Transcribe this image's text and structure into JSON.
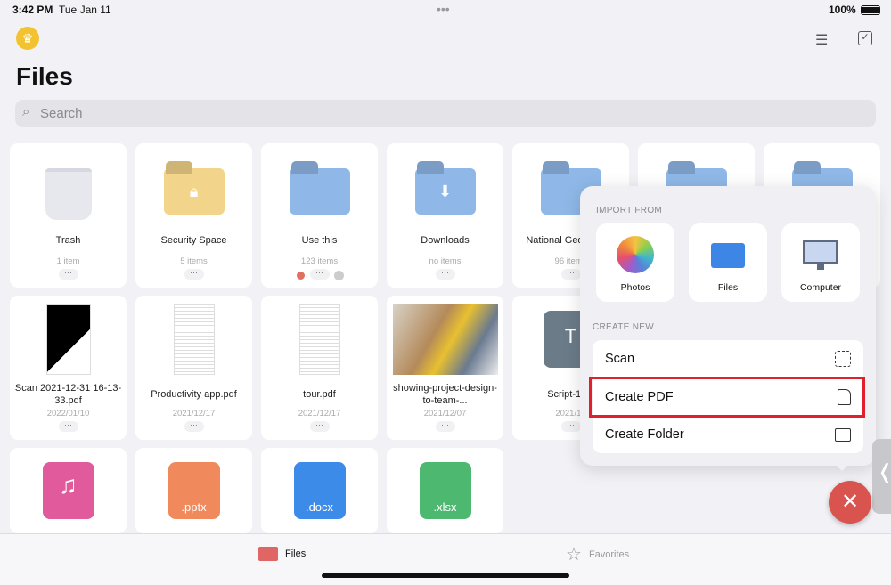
{
  "status": {
    "time": "3:42 PM",
    "date": "Tue Jan 11",
    "battery": "100%"
  },
  "header": {
    "title": "Files",
    "search_placeholder": "Search"
  },
  "row1": [
    {
      "name": "Trash",
      "sub": "1 item",
      "icon": "trash-icon"
    },
    {
      "name": "Security Space",
      "sub": "5 items",
      "icon": "lock-folder-icon"
    },
    {
      "name": "Use this",
      "sub": "123 items",
      "icon": "folder-icon"
    },
    {
      "name": "Downloads",
      "sub": "no items",
      "icon": "download-folder-icon"
    },
    {
      "name": "National Geographic",
      "sub": "96 items",
      "icon": "folder-icon"
    },
    {
      "name": "",
      "sub": "",
      "icon": "folder-icon"
    },
    {
      "name": "",
      "sub": "",
      "icon": "folder-icon"
    }
  ],
  "row2": [
    {
      "name": "Scan 2021-12-31 16-13-33.pdf",
      "sub": "2022/01/10"
    },
    {
      "name": "Productivity app.pdf",
      "sub": "2021/12/17"
    },
    {
      "name": "tour.pdf",
      "sub": "2021/12/17"
    },
    {
      "name": "showing-project-design-to-team-...",
      "sub": "2021/12/07"
    },
    {
      "name": "Script-1.txt",
      "sub": "2021/12",
      "ext": ".t"
    }
  ],
  "row3": [
    {
      "ext": "",
      "icon": "music-file-icon",
      "color": "#e05a9c"
    },
    {
      "ext": ".pptx",
      "icon": "pptx-file-icon",
      "color": "#f08a5d"
    },
    {
      "ext": ".docx",
      "icon": "docx-file-icon",
      "color": "#3d8be8"
    },
    {
      "ext": ".xlsx",
      "icon": "xlsx-file-icon",
      "color": "#4cb870"
    }
  ],
  "popup": {
    "import_label": "IMPORT FROM",
    "import": [
      "Photos",
      "Files",
      "Computer"
    ],
    "create_label": "CREATE NEW",
    "create": [
      "Scan",
      "Create PDF",
      "Create Folder"
    ],
    "highlight": "Create PDF",
    "highlight_color": "#e0202a"
  },
  "tabs": [
    "Files",
    "Favorites"
  ],
  "colors": {
    "fab": "#d9534f",
    "folder": "#8fb8e8",
    "secure_folder": "#f2d48a"
  }
}
